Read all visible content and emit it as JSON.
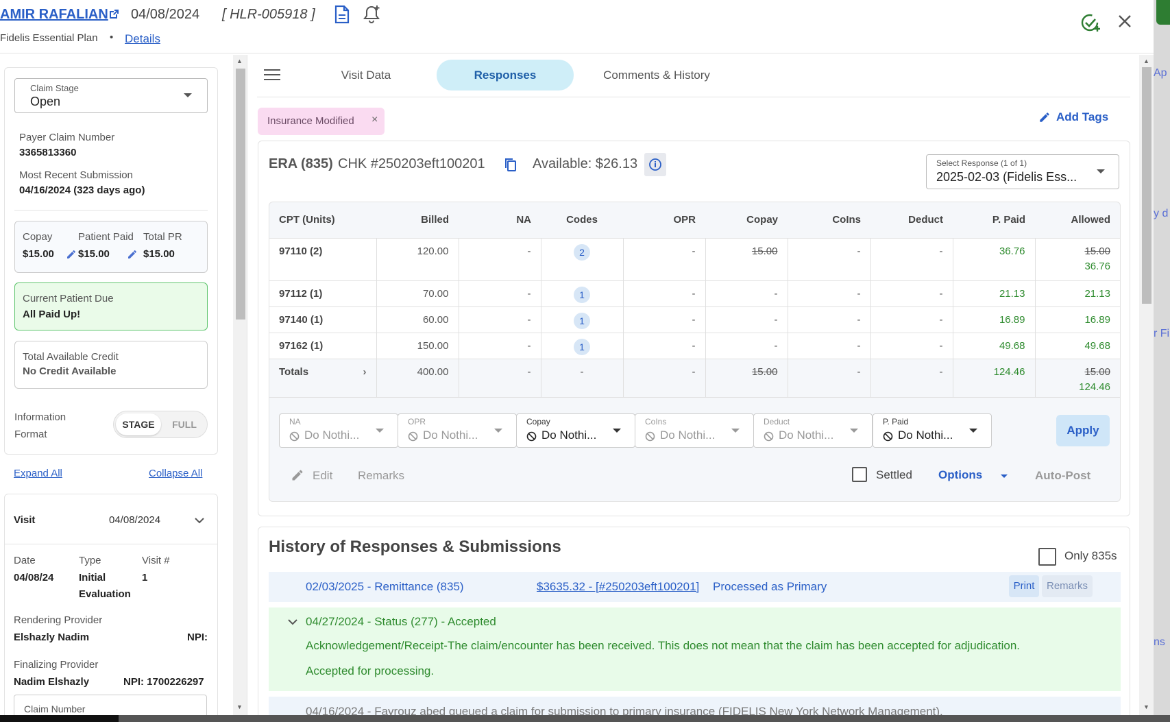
{
  "header": {
    "patient_name": "AMIR RAFALIAN",
    "date": "04/08/2024",
    "claim_id": "[ HLR-005918 ]",
    "plan": "Fidelis Essential Plan",
    "plan_dot": "•",
    "details_link": "Details"
  },
  "sidebar": {
    "claim_stage_label": "Claim Stage",
    "claim_stage_value": "Open",
    "payer_claim_label": "Payer Claim Number",
    "payer_claim_value": "3365813360",
    "recent_submission_label": "Most Recent Submission",
    "recent_submission_value": "04/16/2024 (323 days ago)",
    "copay_label": "Copay",
    "copay_value": "$15.00",
    "patient_paid_label": "Patient Paid",
    "patient_paid_value": "$15.00",
    "total_pr_label": "Total PR",
    "total_pr_value": "$15.00",
    "current_due_label": "Current Patient Due",
    "current_due_value": "All Paid Up!",
    "credit_label": "Total Available Credit",
    "credit_value": "No Credit Available",
    "info_format_label_1": "Information",
    "info_format_label_2": "Format",
    "format_stage": "STAGE",
    "format_full": "FULL",
    "expand_all": "Expand All",
    "collapse_all": "Collapse All",
    "visit_label": "Visit",
    "visit_date": "04/08/2024",
    "date_label": "Date",
    "date_value": "04/08/24",
    "type_label": "Type",
    "type_value_1": "Initial",
    "type_value_2": "Evaluation",
    "visit_num_label": "Visit #",
    "visit_num_value": "1",
    "rendering_label": "Rendering Provider",
    "rendering_name": "Elshazly Nadim",
    "rendering_npi": "NPI:",
    "finalizing_label": "Finalizing Provider",
    "finalizing_name": "Nadim Elshazly",
    "finalizing_npi": "NPI: 1700226297",
    "claim_number_label": "Claim Number"
  },
  "tabs": [
    {
      "label": "Visit Data"
    },
    {
      "label": "Responses"
    },
    {
      "label": "Comments & History"
    }
  ],
  "tag_chip": {
    "label": "Insurance Modified",
    "close": "×"
  },
  "add_tags": "Add Tags",
  "era": {
    "title": "ERA (835)",
    "check": "CHK #250203eft100201",
    "available": "Available: $26.13",
    "select_label": "Select Response (1 of 1)",
    "select_value": "2025-02-03 (Fidelis Ess..."
  },
  "table": {
    "headers": [
      "CPT (Units)",
      "Billed",
      "NA",
      "Codes",
      "OPR",
      "Copay",
      "CoIns",
      "Deduct",
      "P. Paid",
      "Allowed"
    ],
    "rows": [
      {
        "cpt": "97110 (2)",
        "billed": "120.00",
        "na": "-",
        "codes": "2",
        "opr": "-",
        "copay": "15.00",
        "coins": "-",
        "deduct": "-",
        "ppaid": "36.76",
        "allowed_old": "15.00",
        "allowed": "36.76"
      },
      {
        "cpt": "97112 (1)",
        "billed": "70.00",
        "na": "-",
        "codes": "1",
        "opr": "-",
        "copay": "-",
        "coins": "-",
        "deduct": "-",
        "ppaid": "21.13",
        "allowed": "21.13"
      },
      {
        "cpt": "97140 (1)",
        "billed": "60.00",
        "na": "-",
        "codes": "1",
        "opr": "-",
        "copay": "-",
        "coins": "-",
        "deduct": "-",
        "ppaid": "16.89",
        "allowed": "16.89"
      },
      {
        "cpt": "97162 (1)",
        "billed": "150.00",
        "na": "-",
        "codes": "1",
        "opr": "-",
        "copay": "-",
        "coins": "-",
        "deduct": "-",
        "ppaid": "49.68",
        "allowed": "49.68"
      }
    ],
    "totals": {
      "label": "Totals",
      "chev": "›",
      "billed": "400.00",
      "na": "-",
      "codes": "-",
      "opr": "-",
      "copay": "15.00",
      "coins": "-",
      "deduct": "-",
      "ppaid": "124.46",
      "allowed_old": "15.00",
      "allowed": "124.46"
    }
  },
  "adjust_dropdowns": [
    {
      "label": "NA",
      "value": "Do Nothi..."
    },
    {
      "label": "OPR",
      "value": "Do Nothi..."
    },
    {
      "label": "Copay",
      "value": "Do Nothi..."
    },
    {
      "label": "CoIns",
      "value": "Do Nothi..."
    },
    {
      "label": "Deduct",
      "value": "Do Nothi..."
    },
    {
      "label": "P. Paid",
      "value": "Do Nothi..."
    }
  ],
  "actions": {
    "apply": "Apply",
    "edit": "Edit",
    "remarks": "Remarks",
    "settled": "Settled",
    "options": "Options",
    "auto_post": "Auto-Post"
  },
  "history": {
    "title": "History of Responses & Submissions",
    "only_835": "Only 835s",
    "row1_title": "02/03/2025 - Remittance (835)",
    "row1_amount": "$3635.32 - [#250203eft100201]",
    "row1_status": "Processed as Primary",
    "row1_print": "Print",
    "row1_remarks": "Remarks",
    "row2_title": "04/27/2024 - Status (277) - Accepted",
    "row2_line1": "Acknowledgement/Receipt-The claim/encounter has been received. This does not mean that the claim has been accepted for adjudication.",
    "row2_line2": "Accepted for processing.",
    "row3_text": "04/16/2024 - Fayrouz abed queued a claim for submission to primary insurance (FIDELIS New York Network Management)."
  },
  "background_partial": {
    "t1": "Ap",
    "t2": "y d",
    "t3": "r Fi",
    "t4": "ns"
  },
  "colors": {
    "link_blue": "#2a5fc7",
    "active_tab_bg": "#cfeef8",
    "tag_pink": "#fadbf1",
    "paid_green": "#2e8b2e",
    "due_green_bg": "#eafbe9"
  }
}
